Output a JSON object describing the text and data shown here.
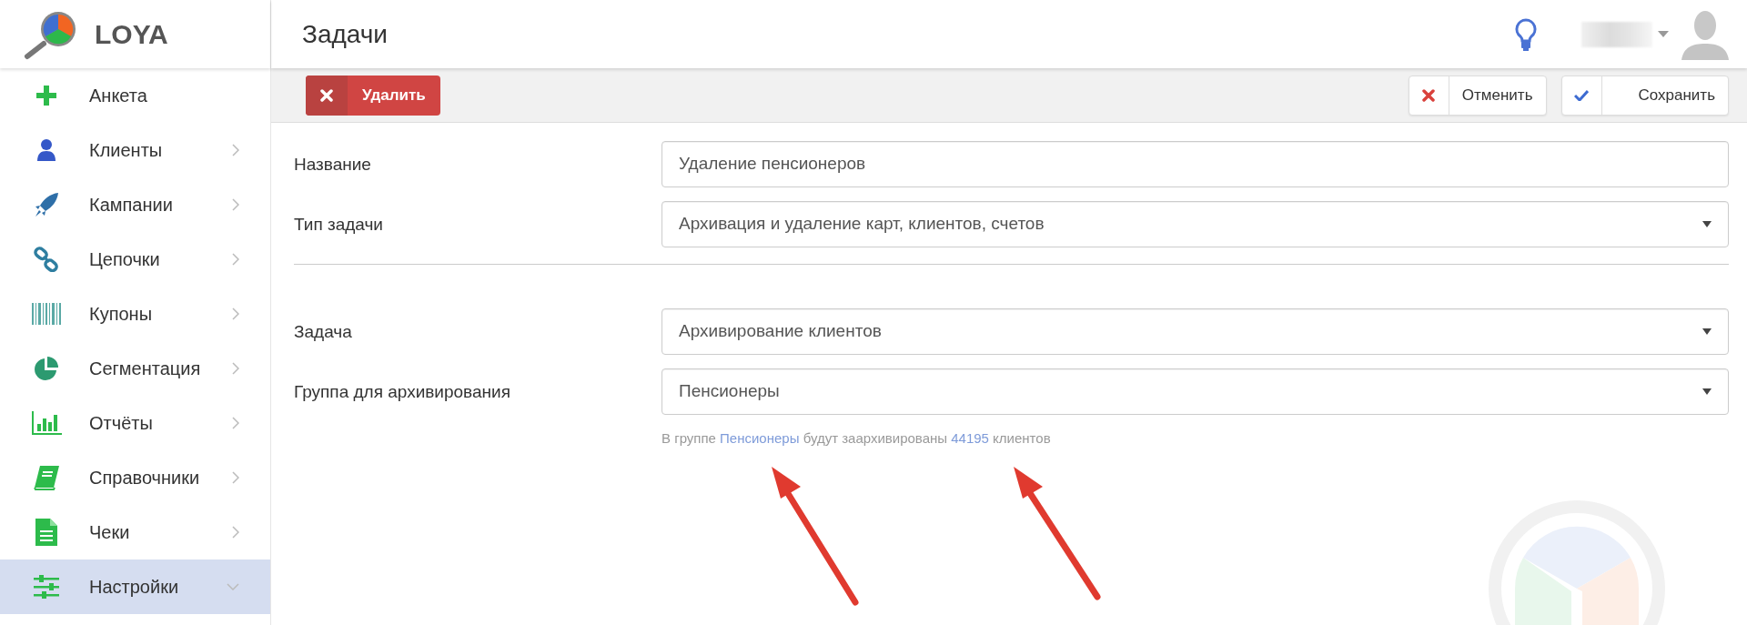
{
  "app": {
    "name": "LOYA"
  },
  "page_title": "Задачи",
  "sidebar": {
    "items": [
      {
        "label": "Анкета",
        "selected": false
      },
      {
        "label": "Клиенты",
        "selected": false,
        "expanded": false
      },
      {
        "label": "Кампании",
        "selected": false,
        "expanded": false
      },
      {
        "label": "Цепочки",
        "selected": false,
        "expanded": false
      },
      {
        "label": "Купоны",
        "selected": false,
        "expanded": false
      },
      {
        "label": "Сегментация",
        "selected": false,
        "expanded": false
      },
      {
        "label": "Отчёты",
        "selected": false,
        "expanded": false
      },
      {
        "label": "Справочники",
        "selected": false,
        "expanded": false
      },
      {
        "label": "Чеки",
        "selected": false,
        "expanded": false
      },
      {
        "label": "Настройки",
        "selected": true,
        "expanded": true
      }
    ]
  },
  "toolbar": {
    "delete_button": {
      "label": "Удалить"
    },
    "cancel_button": {
      "label": "Отменить"
    },
    "save_button": {
      "label": "Сохранить"
    }
  },
  "form": {
    "sections": [
      {
        "fields": [
          {
            "kind": "text",
            "label": "Название",
            "value": "Удаление пенсионеров"
          },
          {
            "kind": "select",
            "label": "Тип задачи",
            "value": "Архивация и удаление карт, клиентов, счетов"
          }
        ]
      },
      {
        "fields": [
          {
            "kind": "select",
            "label": "Задача",
            "value": "Архивирование клиентов"
          },
          {
            "kind": "select",
            "label": "Группа для архивирования",
            "value": "Пенсионеры"
          }
        ]
      }
    ],
    "hint": [
      {
        "kind": "plain",
        "text": "В группе "
      },
      {
        "kind": "link",
        "text": "Пенсионеры"
      },
      {
        "kind": "plain",
        "text": " будут заархивированы "
      },
      {
        "kind": "link",
        "text": "44195"
      },
      {
        "kind": "plain",
        "text": " клиентов"
      }
    ]
  }
}
